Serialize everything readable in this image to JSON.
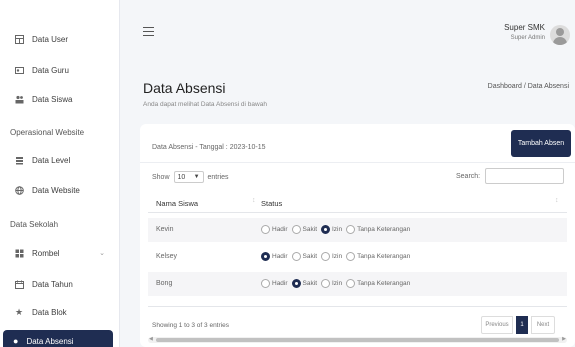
{
  "sidebar": {
    "items": [
      {
        "label": "Data User",
        "icon": "table-icon"
      },
      {
        "label": "Data Guru",
        "icon": "id-card-icon"
      },
      {
        "label": "Data Siswa",
        "icon": "users-icon"
      }
    ],
    "section_operasional": "Operasional Website",
    "operasional_items": [
      {
        "label": "Data Level",
        "icon": "layers-icon"
      },
      {
        "label": "Data Website",
        "icon": "globe-icon"
      }
    ],
    "section_sekolah": "Data Sekolah",
    "sekolah_items": [
      {
        "label": "Rombel",
        "icon": "grid-icon"
      },
      {
        "label": "Data Tahun",
        "icon": "calendar-icon"
      },
      {
        "label": "Data Blok",
        "icon": "star-icon"
      }
    ],
    "active_item": {
      "label": "Data Absensi",
      "icon": "user-check-icon"
    }
  },
  "header": {
    "user_name": "Super SMK",
    "user_role": "Super Admin"
  },
  "page": {
    "title": "Data Absensi",
    "subtitle": "Anda dapat melihat Data Absensi di bawah",
    "breadcrumb": "Dashboard / Data Absensi"
  },
  "card": {
    "title": "Data Absensi - Tanggal : 2023-10-15",
    "add_button": "Tambah Absen",
    "show_label": "Show",
    "show_value": "10",
    "entries_label": "entries",
    "search_label": "Search:"
  },
  "table": {
    "columns": [
      "Nama Siswa",
      "Status"
    ],
    "status_options": [
      "Hadir",
      "Sakit",
      "Izin",
      "Tanpa Keterangan"
    ],
    "rows": [
      {
        "name": "Kevin",
        "selected": "Izin"
      },
      {
        "name": "Kelsey",
        "selected": "Hadir"
      },
      {
        "name": "Bong",
        "selected": "Sakit"
      }
    ]
  },
  "footer": {
    "entries_info": "Showing 1 to 3 of 3 entries",
    "prev_label": "Previous",
    "page_number": "1",
    "next_label": "Next"
  },
  "colors": {
    "primary": "#1f2d52",
    "background": "#f4f6f9"
  }
}
